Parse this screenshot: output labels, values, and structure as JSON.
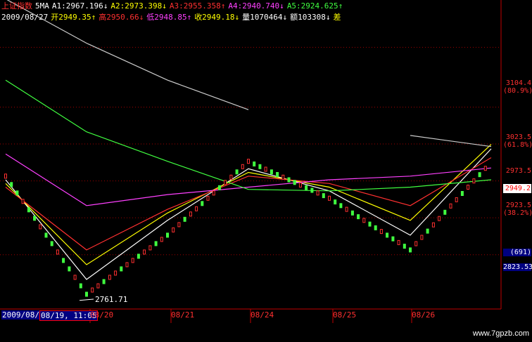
{
  "header": {
    "index_name": "上证指数",
    "ma_label": "5MA",
    "a1": "A1:2967.196↓",
    "a2": "A2:2973.398↓",
    "a3": "A3:2955.358↑",
    "a4": "A4:2940.740↓",
    "a5": "A5:2924.625↑",
    "date": "2009/08/27",
    "open": "开2949.35↑",
    "high": "高2950.66↓",
    "low": "低2948.85↑",
    "close": "收2949.18↓",
    "volume": "量1070464↓",
    "amount": "额103308↓",
    "tail": "差",
    "colors": {
      "index": "#ff3030",
      "ma": "#ffffff",
      "a1": "#ffffff",
      "a2": "#ffff00",
      "a3": "#ff3030",
      "a4": "#ff40ff",
      "a5": "#40ff40",
      "date": "#ffffff",
      "open": "#ffff00",
      "high": "#ff3030",
      "low": "#ff40ff",
      "close": "#ffff00",
      "volume": "#ffffff",
      "amount": "#ffffff"
    }
  },
  "right_axis": {
    "levels": [
      {
        "value": "3104.4",
        "pct": "(80.9%)"
      },
      {
        "value": "3023.5",
        "pct": "(61.8%)"
      },
      {
        "value": "2973.5",
        "pct": ""
      },
      {
        "value": "2923.5",
        "pct": "(38.2%)"
      },
      {
        "value": "(691)",
        "pct": ""
      },
      {
        "value": "2823.53",
        "pct": ""
      }
    ],
    "current_price": "2949.2",
    "current_color": "#ff3030"
  },
  "low_marker": "2761.71",
  "date_axis": {
    "first_box": "2009/08/1",
    "second_box": "08/19, 11:05",
    "labels": [
      "08/20",
      "08/21",
      "08/24",
      "08/25",
      "08/26"
    ]
  },
  "watermark": "www.7gpzb.com",
  "chart_data": {
    "type": "line",
    "title": "",
    "xlabel": "",
    "ylabel": "",
    "ylim": [
      2750,
      3140
    ],
    "x": [
      "08/19",
      "08/20",
      "08/21",
      "08/24",
      "08/25",
      "08/26",
      "08/27"
    ],
    "series": [
      {
        "name": "",
        "color": "#40ff40",
        "role": "price",
        "values": [
          2930,
          2770,
          2850,
          2950,
          2900,
          2830,
          2949
        ]
      },
      {
        "name": "A1",
        "color": "#ffffff",
        "values": [
          2925,
          2790,
          2870,
          2940,
          2910,
          2850,
          2967
        ]
      },
      {
        "name": "A2",
        "color": "#ffff00",
        "values": [
          2920,
          2810,
          2880,
          2935,
          2915,
          2870,
          2973
        ]
      },
      {
        "name": "A3",
        "color": "#ff3030",
        "values": [
          2915,
          2830,
          2885,
          2930,
          2920,
          2890,
          2955
        ]
      },
      {
        "name": "A4",
        "color": "#ff40ff",
        "values": [
          2960,
          2890,
          2905,
          2915,
          2925,
          2930,
          2941
        ]
      },
      {
        "name": "A5",
        "color": "#40ff40",
        "values": [
          3060,
          2990,
          2950,
          2912,
          2910,
          2915,
          2925
        ]
      },
      {
        "name": "",
        "color": "#cccccc",
        "role": "long-ma",
        "values": [
          3170,
          3110,
          3060,
          3020,
          null,
          2985,
          2970
        ]
      }
    ],
    "reference_levels": [
      3104.4,
      3023.5,
      2973.5,
      2923.5,
      2873.5,
      2823.53
    ],
    "low_value": 2761.71,
    "grid": true,
    "legend": "top"
  }
}
